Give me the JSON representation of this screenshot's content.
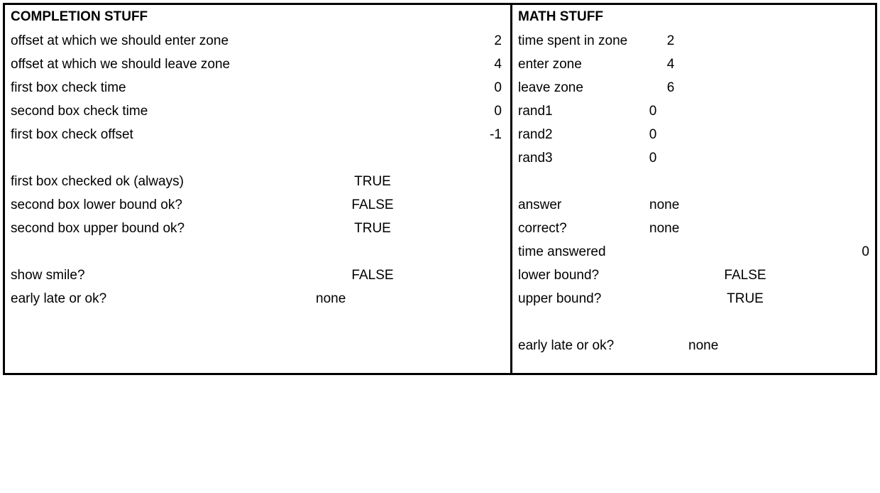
{
  "left": {
    "title": "COMPLETION STUFF",
    "rows_a": [
      {
        "label": "offset at which we should enter zone",
        "value": "2"
      },
      {
        "label": "offset at which we should leave zone",
        "value": "4"
      },
      {
        "label": "first box check time",
        "value": "0"
      },
      {
        "label": "second box check time",
        "value": "0"
      },
      {
        "label": "first box check offset",
        "value": "-1"
      }
    ],
    "rows_b": [
      {
        "label": "first box checked ok (always)",
        "value": "TRUE"
      },
      {
        "label": "second box lower bound ok?",
        "value": "FALSE"
      },
      {
        "label": "second box upper bound ok?",
        "value": "TRUE"
      }
    ],
    "rows_c": [
      {
        "label": "show smile?",
        "value": "FALSE"
      },
      {
        "label": "early late or ok?",
        "value": "none"
      }
    ]
  },
  "right": {
    "title": "MATH STUFF",
    "rows_a": [
      {
        "label": "time spent in zone",
        "value": "2"
      },
      {
        "label": "enter zone",
        "value": "4"
      },
      {
        "label": "leave zone",
        "value": "6"
      }
    ],
    "rows_b": [
      {
        "label": "rand1",
        "value": "0"
      },
      {
        "label": "rand2",
        "value": "0"
      },
      {
        "label": "rand3",
        "value": "0"
      }
    ],
    "rows_c": [
      {
        "label": "answer",
        "value": "none"
      },
      {
        "label": "correct?",
        "value": "none"
      }
    ],
    "rows_d": [
      {
        "label": "time answered",
        "value": "0"
      }
    ],
    "rows_e": [
      {
        "label": "lower bound?",
        "value": "FALSE"
      },
      {
        "label": "upper bound?",
        "value": "TRUE"
      }
    ],
    "rows_f": [
      {
        "label": "early late or ok?",
        "value": "none"
      }
    ]
  }
}
